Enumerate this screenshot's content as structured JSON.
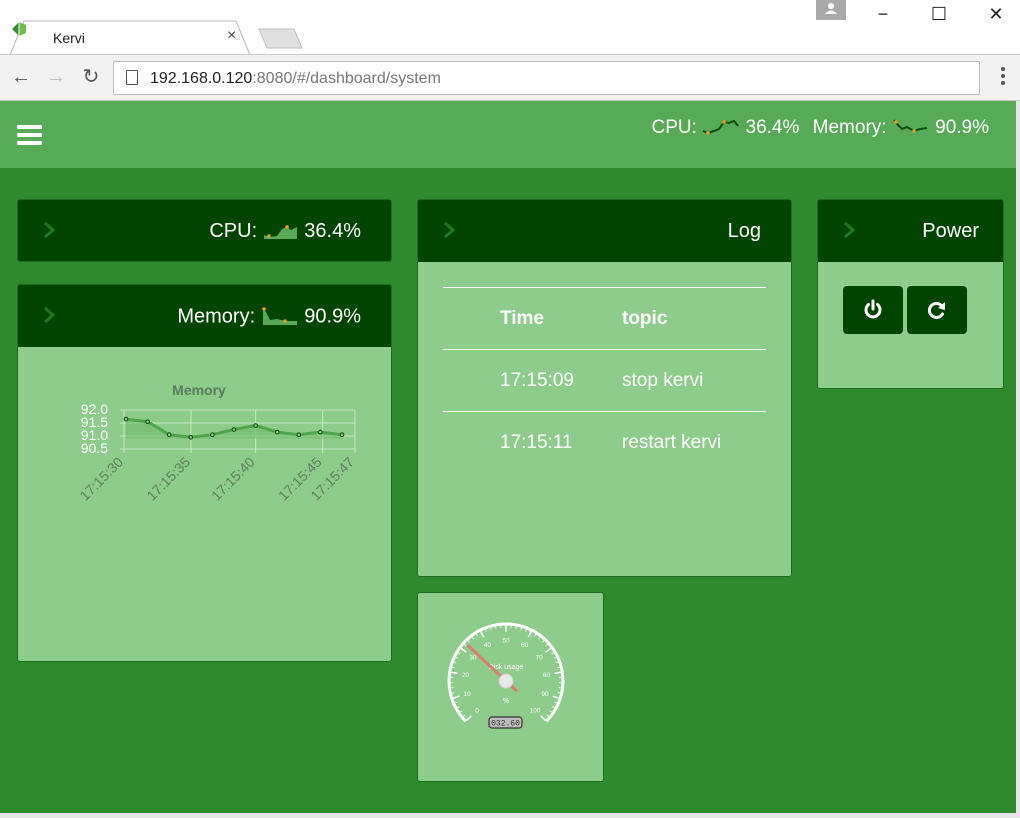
{
  "browser": {
    "tab_title": "Kervi",
    "tab_close": "×",
    "url_host": "192.168.0.120",
    "url_rest": ":8080/#/dashboard/system",
    "window_controls": {
      "minimize": "−",
      "maximize": "☐",
      "close": "✕"
    },
    "nav": {
      "back": "←",
      "forward": "→",
      "reload": "↻"
    }
  },
  "header": {
    "cpu_label": "CPU:",
    "cpu_value": "36.4%",
    "memory_label": "Memory:",
    "memory_value": "90.9%"
  },
  "cpu_panel": {
    "label": "CPU:",
    "value": "36.4%"
  },
  "memory_panel": {
    "label": "Memory:",
    "value": "90.9%"
  },
  "memory_chart_title": "Memory",
  "chart_data": {
    "type": "line",
    "title": "Memory",
    "y_ticks": [
      "92.0",
      "91.5",
      "91.0",
      "90.5"
    ],
    "ylim": [
      90.5,
      92.0
    ],
    "x_tick_labels": [
      "17:15:30",
      "17:15:35",
      "17:15:40",
      "17:15:45",
      "17:15:47"
    ],
    "series": [
      {
        "values": [
          91.65,
          91.55,
          91.05,
          90.95,
          91.05,
          91.25,
          91.4,
          91.15,
          91.05,
          91.15,
          91.05
        ]
      }
    ],
    "grid": true
  },
  "log_panel": {
    "title": "Log",
    "columns": [
      "Time",
      "topic"
    ],
    "rows": [
      [
        "17:15:09",
        "stop kervi"
      ],
      [
        "17:15:11",
        "restart kervi"
      ]
    ]
  },
  "power_panel": {
    "title": "Power",
    "buttons": [
      "power-icon",
      "restart-icon"
    ]
  },
  "gauge": {
    "label": "Disk usage",
    "unit": "%",
    "value_text": "032.60",
    "value": 32.6,
    "ticks": [
      "0",
      "10",
      "20",
      "30",
      "40",
      "50",
      "60",
      "70",
      "80",
      "90",
      "100"
    ]
  },
  "colors": {
    "app_bg": "#2d8a2d",
    "header_bg": "#57ab57",
    "panel_head": "#004400",
    "panel_body": "#8dcc8a"
  }
}
